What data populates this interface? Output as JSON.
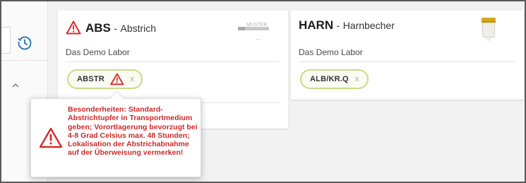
{
  "colors": {
    "warning_red": "#d62b2b",
    "chip_border": "#c9db86",
    "accent_blue": "#1f6fb2"
  },
  "sidebar": {
    "icons": [
      "clock-icon",
      "chevron-up-icon"
    ]
  },
  "cards": [
    {
      "code": "ABS",
      "separator": "-",
      "name": "Abstrich",
      "lab": "Das Demo Labor",
      "image_caption": "MUSTER",
      "image_icon": "swab-sample-image",
      "has_warning": true,
      "chip": {
        "label": "ABSTR",
        "remove": "x",
        "has_warning": true
      }
    },
    {
      "code": "HARN",
      "separator": "-",
      "name": "Harnbecher",
      "lab": "Das Demo Labor",
      "image_icon": "urine-cup-image",
      "has_warning": false,
      "chip": {
        "label": "ALB/KR.Q",
        "remove": "x",
        "has_warning": false
      }
    }
  ],
  "tooltip": {
    "text": "Besonderheiten: Standard-Abstrichtupfer in Transportmedium geben; Vorortlagerung bevorzugt bei 4-8 Grad Celsius max. 48 Stunden; Lokalisation der Abstrichabnahme auf der Überweisung vermerken!",
    "icon": "warning-icon"
  }
}
